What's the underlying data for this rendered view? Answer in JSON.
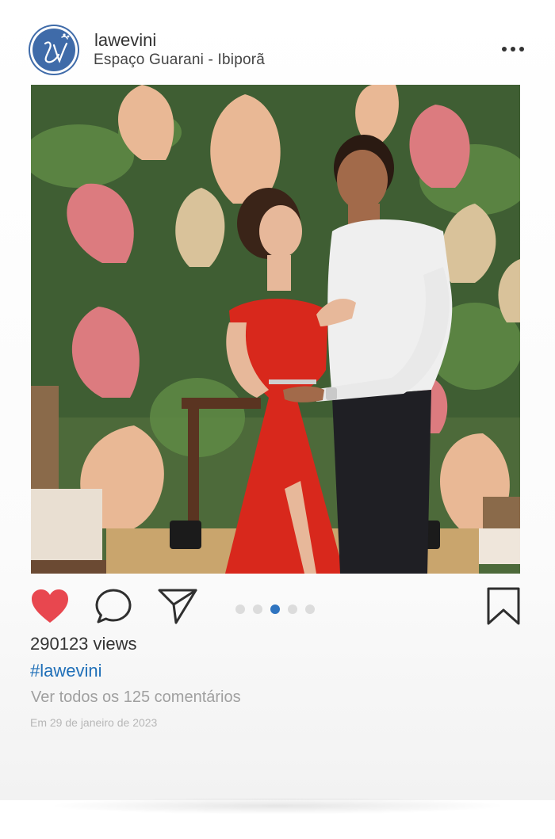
{
  "post": {
    "username": "lawevini",
    "location": "Espaço Guarani - Ibiporã",
    "avatar_initials": "LV",
    "views": "290123 views",
    "hashtag": "#lawevini",
    "comments_link": "Ver todos os 125 comentários",
    "date": "Em 29 de janeiro de 2023",
    "carousel": {
      "count": 5,
      "active_index": 2
    }
  },
  "icons": {
    "more": "more-horizontal-icon",
    "like": "heart-icon",
    "comment": "comment-bubble-icon",
    "share": "paper-plane-icon",
    "save": "bookmark-icon"
  },
  "colors": {
    "like": "#e8474f",
    "link": "#1f6fb8",
    "avatar": "#3f6ba9",
    "active_dot": "#2f74c0",
    "inactive_dot": "#dcdcdc"
  }
}
